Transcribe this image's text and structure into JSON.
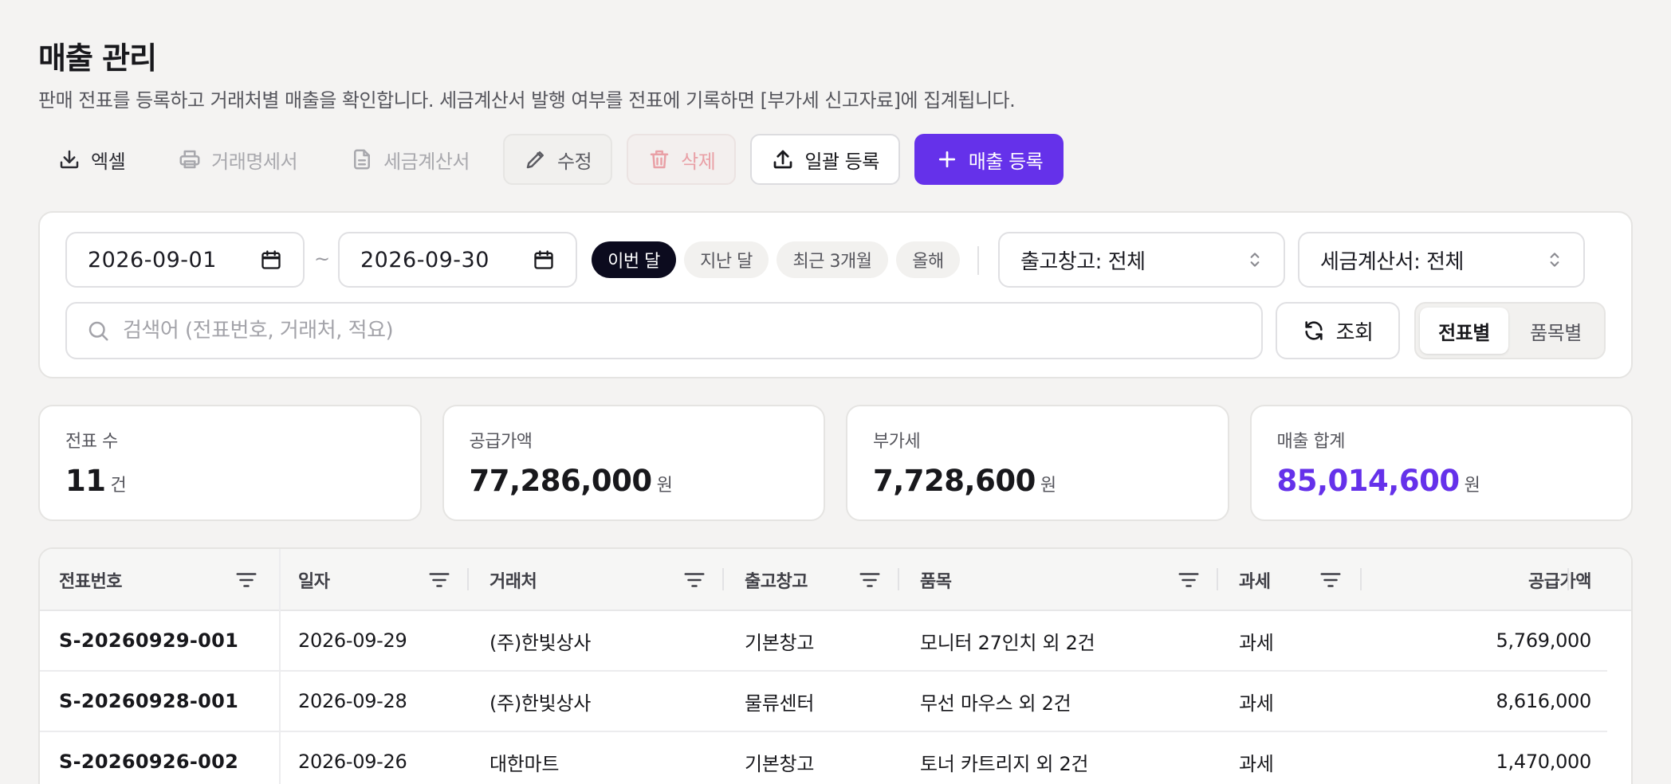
{
  "page": {
    "title": "매출 관리",
    "subtitle": "판매 전표를 등록하고 거래처별 매출을 확인합니다. 세금계산서 발행 여부를 전표에 기록하면 [부가세 신고자료]에 집계됩니다."
  },
  "toolbar": {
    "excel": "엑셀",
    "statement": "거래명세서",
    "tax_invoice": "세금계산서",
    "edit": "수정",
    "delete": "삭제",
    "bulk_upload": "일괄 등록",
    "add_sale": "매출 등록"
  },
  "filters": {
    "date_from": "2026-09-01",
    "date_to": "2026-09-30",
    "range_separator": "~",
    "presets": [
      "이번 달",
      "지난 달",
      "최근 3개월",
      "올해"
    ],
    "active_preset": "이번 달",
    "warehouse_select": "출고창고: 전체",
    "tax_invoice_select": "세금계산서: 전체",
    "search_placeholder": "검색어 (전표번호, 거래처, 적요)",
    "search_value": "",
    "refresh_label": "조회",
    "view_modes": [
      "전표별",
      "품목별"
    ],
    "active_view": "전표별"
  },
  "stats": [
    {
      "label": "전표 수",
      "value": "11",
      "unit": "건"
    },
    {
      "label": "공급가액",
      "value": "77,286,000",
      "unit": "원"
    },
    {
      "label": "부가세",
      "value": "7,728,600",
      "unit": "원"
    },
    {
      "label": "매출 합계",
      "value": "85,014,600",
      "unit": "원"
    }
  ],
  "table": {
    "columns": [
      "전표번호",
      "일자",
      "거래처",
      "출고창고",
      "품목",
      "과세",
      "공급가액"
    ],
    "rows": [
      [
        "S-20260929-001",
        "2026-09-29",
        "(주)한빛상사",
        "기본창고",
        "모니터 27인치 외 2건",
        "과세",
        "5,769,000"
      ],
      [
        "S-20260928-001",
        "2026-09-28",
        "(주)한빛상사",
        "물류센터",
        "무선 마우스 외 2건",
        "과세",
        "8,616,000"
      ],
      [
        "S-20260926-002",
        "2026-09-26",
        "대한마트",
        "기본창고",
        "토너 카트리지 외 2건",
        "과세",
        "1,470,000"
      ]
    ]
  },
  "colors": {
    "accent": "#6531ea",
    "active_chip": "#0c0b1e",
    "delete_text": "#e9a0a6",
    "background": "#f4f3f2"
  },
  "icons": {
    "excel": "download-icon",
    "statement": "printer-icon",
    "tax_invoice": "document-icon",
    "edit": "pencil-icon",
    "delete": "trash-icon",
    "bulk_upload": "upload-icon",
    "add_sale": "plus-icon",
    "date": "calendar-icon",
    "select": "chevron-updown-icon",
    "search": "search-icon",
    "refresh": "refresh-icon",
    "column_filter": "filter-icon"
  }
}
